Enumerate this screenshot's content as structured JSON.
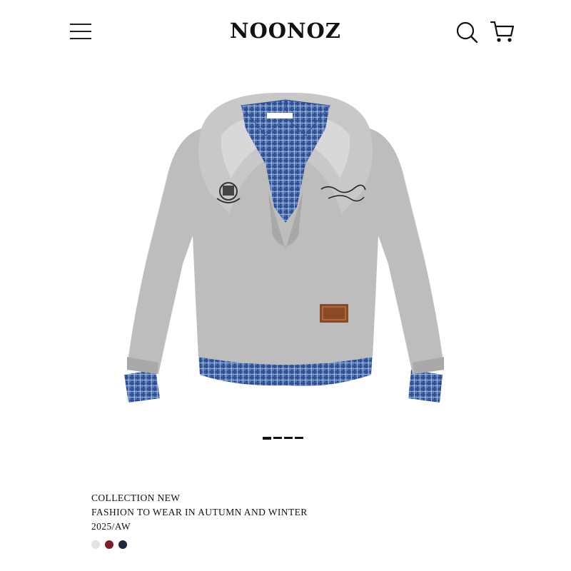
{
  "header": {
    "brand": "NOONOZ",
    "menu_icon": "hamburger-menu-icon",
    "search_icon": "search-icon",
    "cart_icon": "shopping-cart-icon"
  },
  "product": {
    "image": "gray-hoodie-with-blue-plaid-shirt-layer",
    "slide_count": 4
  },
  "collection": {
    "line1": "COLLECTION NEW",
    "line2": "FASHION TO WEAR IN AUTUMN AND WINTER",
    "line3": "2025/AW"
  },
  "colors": {
    "swatches": [
      "#e3e3e3",
      "#7a1c2a",
      "#1c2840"
    ],
    "shirt_blue": "#3f63a8",
    "hoodie_gray": "#bcbcbc"
  }
}
